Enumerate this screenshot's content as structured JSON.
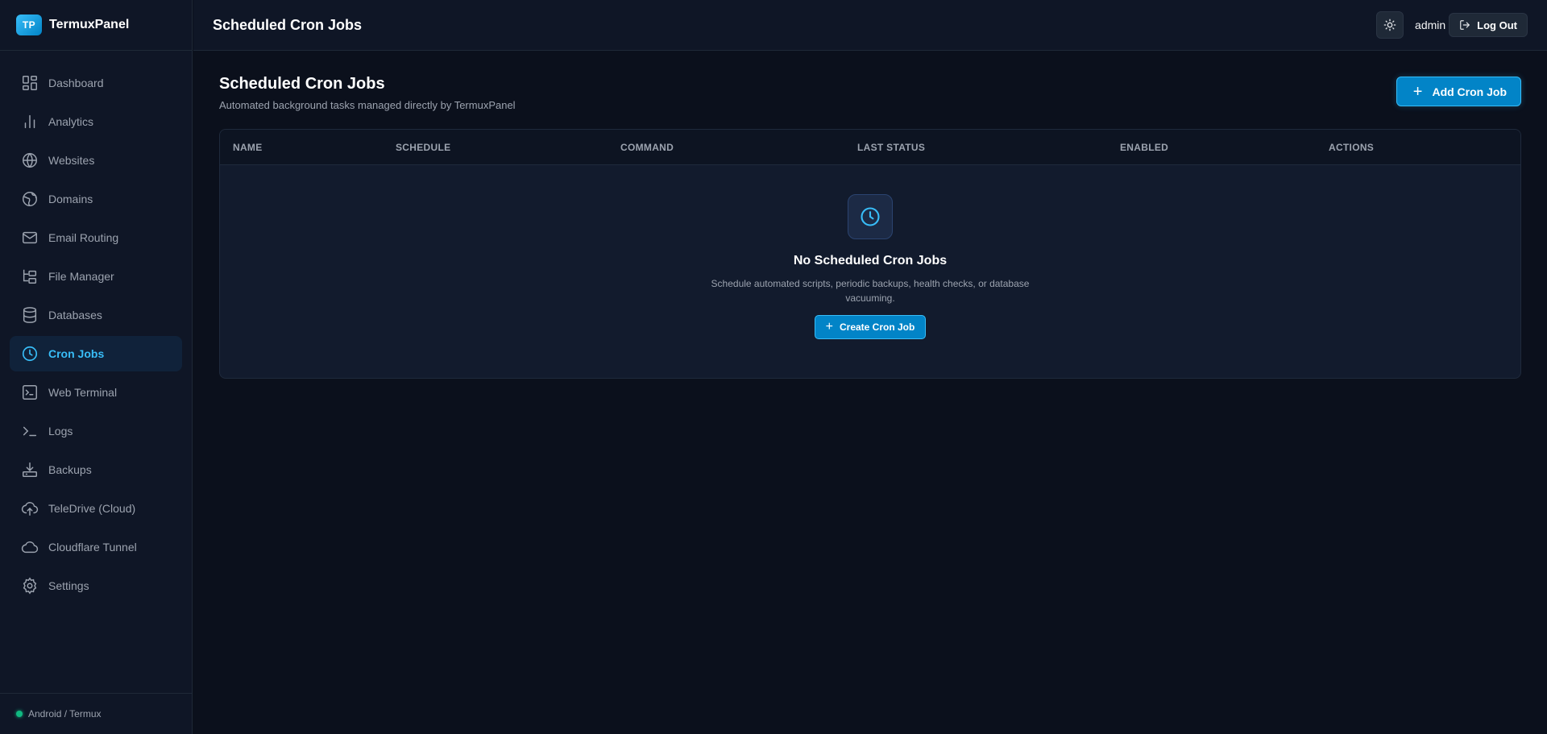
{
  "brand": {
    "badge": "TP",
    "name": "TermuxPanel"
  },
  "sidebar": {
    "items": [
      {
        "label": "Dashboard",
        "icon": "dashboard-icon"
      },
      {
        "label": "Analytics",
        "icon": "bar-chart-icon"
      },
      {
        "label": "Websites",
        "icon": "globe-icon"
      },
      {
        "label": "Domains",
        "icon": "globe-network-icon"
      },
      {
        "label": "Email Routing",
        "icon": "mail-icon"
      },
      {
        "label": "File Manager",
        "icon": "folder-tree-icon"
      },
      {
        "label": "Databases",
        "icon": "database-icon"
      },
      {
        "label": "Cron Jobs",
        "icon": "clock-icon",
        "active": true
      },
      {
        "label": "Web Terminal",
        "icon": "terminal-square-icon"
      },
      {
        "label": "Logs",
        "icon": "terminal-prompt-icon"
      },
      {
        "label": "Backups",
        "icon": "download-icon"
      },
      {
        "label": "TeleDrive (Cloud)",
        "icon": "cloud-upload-icon"
      },
      {
        "label": "Cloudflare Tunnel",
        "icon": "cloud-icon"
      },
      {
        "label": "Settings",
        "icon": "gear-icon"
      }
    ],
    "footer": {
      "status_text": "Android / Termux",
      "status_color": "#10b981"
    }
  },
  "topbar": {
    "title": "Scheduled Cron Jobs",
    "theme_icon": "sun-icon",
    "user": "admin",
    "logout_label": "Log Out",
    "logout_icon": "logout-icon"
  },
  "page": {
    "title": "Scheduled Cron Jobs",
    "subtitle": "Automated background tasks managed directly by TermuxPanel",
    "add_button_label": "Add Cron Job"
  },
  "table": {
    "columns": [
      "NAME",
      "SCHEDULE",
      "COMMAND",
      "LAST STATUS",
      "ENABLED",
      "ACTIONS"
    ],
    "rows": []
  },
  "empty_state": {
    "icon": "clock-icon",
    "title": "No Scheduled Cron Jobs",
    "description": "Schedule automated scripts, periodic backups, health checks, or database vacuuming.",
    "button_label": "Create Cron Job"
  },
  "colors": {
    "accent": "#38bdf8",
    "primary_button": "#0284c7",
    "background": "#0b101c",
    "sidebar": "#0f1626"
  }
}
